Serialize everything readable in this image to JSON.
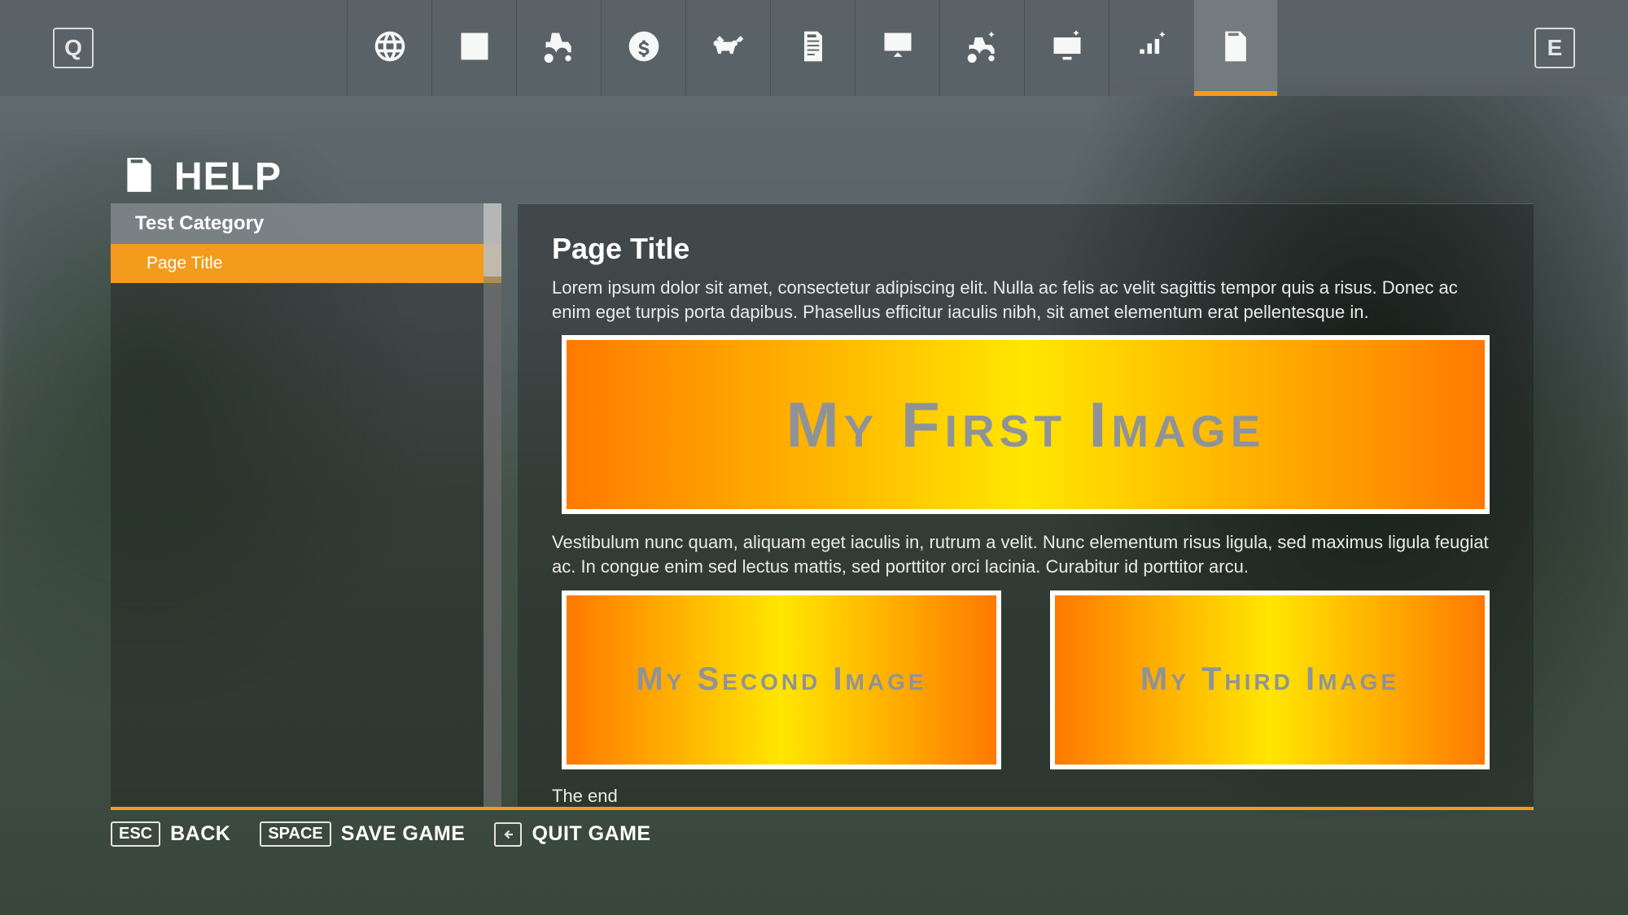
{
  "topbar": {
    "prev_key": "Q",
    "next_key": "E",
    "tabs": [
      {
        "name": "map"
      },
      {
        "name": "chart"
      },
      {
        "name": "vehicles"
      },
      {
        "name": "finance"
      },
      {
        "name": "animals"
      },
      {
        "name": "help"
      },
      {
        "name": "tutorial"
      },
      {
        "name": "vehicle-settings"
      },
      {
        "name": "game-settings"
      },
      {
        "name": "general-settings"
      },
      {
        "name": "help-active"
      }
    ],
    "active_index": 10
  },
  "header": {
    "title": "HELP"
  },
  "sidebar": {
    "category_label": "Test Category",
    "items": [
      {
        "label": "Page Title",
        "selected": true
      }
    ]
  },
  "content": {
    "title": "Page Title",
    "p1": "Lorem ipsum dolor sit amet, consectetur adipiscing elit. Nulla ac felis ac velit sagittis tempor quis a risus. Donec ac enim eget turpis porta dapibus. Phasellus efficitur iaculis nibh, sit amet elementum erat pellentesque in.",
    "image1_label": "My First Image",
    "p2": "Vestibulum nunc quam, aliquam eget iaculis in, rutrum a velit. Nunc elementum risus ligula, sed maximus ligula feugiat ac. In congue enim sed lectus mattis, sed porttitor orci lacinia. Curabitur id porttitor arcu.",
    "image2_label": "My Second Image",
    "image3_label": "My Third Image",
    "p3": "The end"
  },
  "footer": {
    "back_key": "ESC",
    "back_label": "BACK",
    "save_key": "SPACE",
    "save_label": "SAVE GAME",
    "quit_key": "←",
    "quit_label": "QUIT GAME"
  },
  "colors": {
    "accent": "#f29b1d"
  }
}
